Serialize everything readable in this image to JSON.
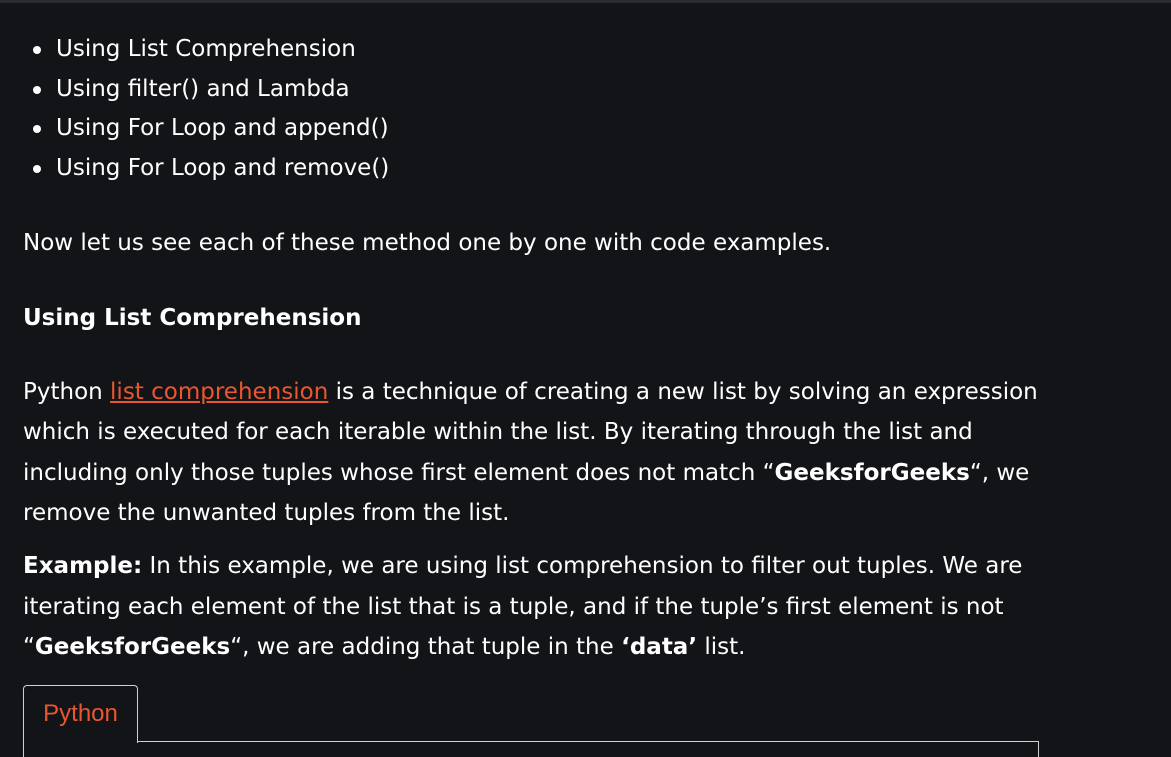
{
  "methods": [
    "Using List Comprehension",
    "Using filter() and Lambda",
    "Using For Loop and append()",
    "Using For Loop and remove()"
  ],
  "intro": "Now let us see each of these method one by one with code examples.",
  "section_heading": "Using List Comprehension",
  "description": {
    "line1_before": "Python ",
    "line1_link": "list comprehension",
    "line1_after": " is a technique of creating a new list by solving an expression",
    "line2": "which is executed for each iterable within the list. By iterating through the list and",
    "line3_before": "including only those tuples whose first element does not match “",
    "line3_bold": "GeeksforGeeks",
    "line3_after": "“, we",
    "line4": "remove the unwanted tuples from the list."
  },
  "example": {
    "label": "Example:",
    "line1_after": " In this example, we are using list comprehension to filter out tuples. We are",
    "line2": "iterating each element of the list that is a tuple, and if the tuple’s first element is not",
    "line3_open": "“",
    "line3_bold": "GeeksforGeeks",
    "line3_mid": "“, we are adding that tuple in the ",
    "line3_bold2": "‘data’",
    "line3_end": " list."
  },
  "code_tab": {
    "label": "Python"
  },
  "colors": {
    "background": "#131417",
    "text": "#ffffff",
    "link": "#e8572f",
    "tab_text": "#e8572f",
    "border": "#d0d0d0"
  }
}
